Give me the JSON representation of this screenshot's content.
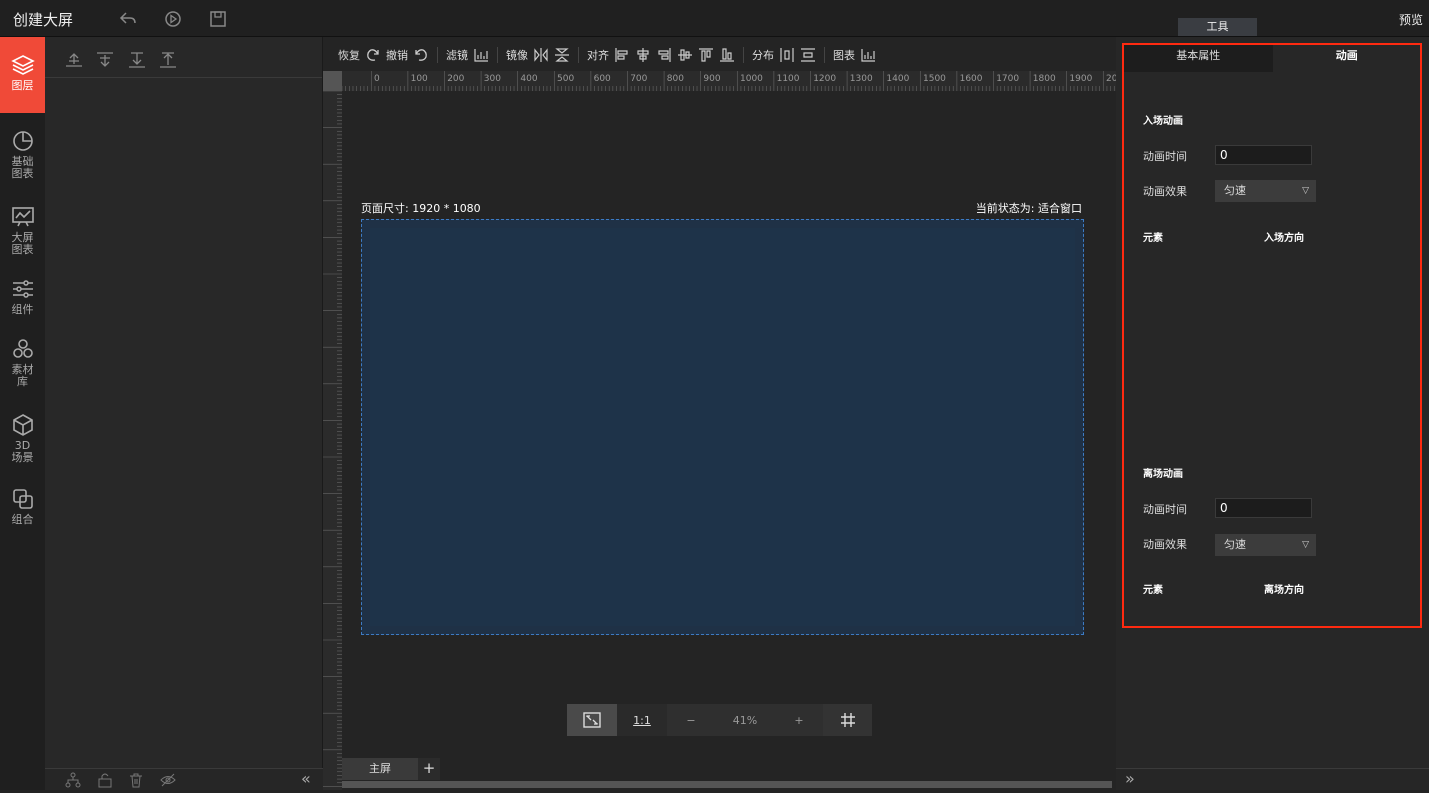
{
  "app": {
    "title": "创建大屏"
  },
  "topbar": {
    "tools_label": "工具",
    "preview_label": "预览"
  },
  "leftnav": {
    "items": [
      {
        "label": "图层",
        "icon": "layers-icon",
        "active": true
      },
      {
        "label": "基础图表",
        "icon": "pie-chart-icon"
      },
      {
        "label": "大屏图表",
        "icon": "monitor-chart-icon"
      },
      {
        "label": "组件",
        "icon": "sliders-icon"
      },
      {
        "label": "素材库",
        "icon": "circles-icon"
      },
      {
        "label": "3D场景",
        "icon": "cube-icon"
      },
      {
        "label": "组合",
        "icon": "group-icon"
      }
    ]
  },
  "toolbar": {
    "redo": "恢复",
    "undo": "撤销",
    "filter": "滤镜",
    "mirror": "镜像",
    "align": "对齐",
    "distribute": "分布",
    "chart": "图表"
  },
  "ruler": {
    "labels": [
      "0",
      "100",
      "200",
      "300",
      "400",
      "500",
      "600",
      "700",
      "800",
      "900",
      "1000",
      "1100",
      "1200",
      "1300",
      "1400",
      "1500",
      "1600",
      "1700",
      "1800",
      "1900",
      "20"
    ]
  },
  "canvas": {
    "page_size": "页面尺寸: 1920 * 1080",
    "state": "当前状态为: 适合窗口"
  },
  "zoom": {
    "one_to_one": "1:1",
    "minus": "−",
    "value": "41%",
    "plus": "+"
  },
  "screens": {
    "main": "主屏",
    "add": "+"
  },
  "rightpanel": {
    "tab_basic": "基本属性",
    "tab_animation": "动画",
    "enter": {
      "title": "入场动画",
      "time_label": "动画时间",
      "time_value": "0",
      "effect_label": "动画效果",
      "effect_value": "匀速",
      "col_element": "元素",
      "col_direction": "入场方向"
    },
    "leave": {
      "title": "离场动画",
      "time_label": "动画时间",
      "time_value": "0",
      "effect_label": "动画效果",
      "effect_value": "匀速",
      "col_element": "元素",
      "col_direction": "离场方向"
    }
  }
}
